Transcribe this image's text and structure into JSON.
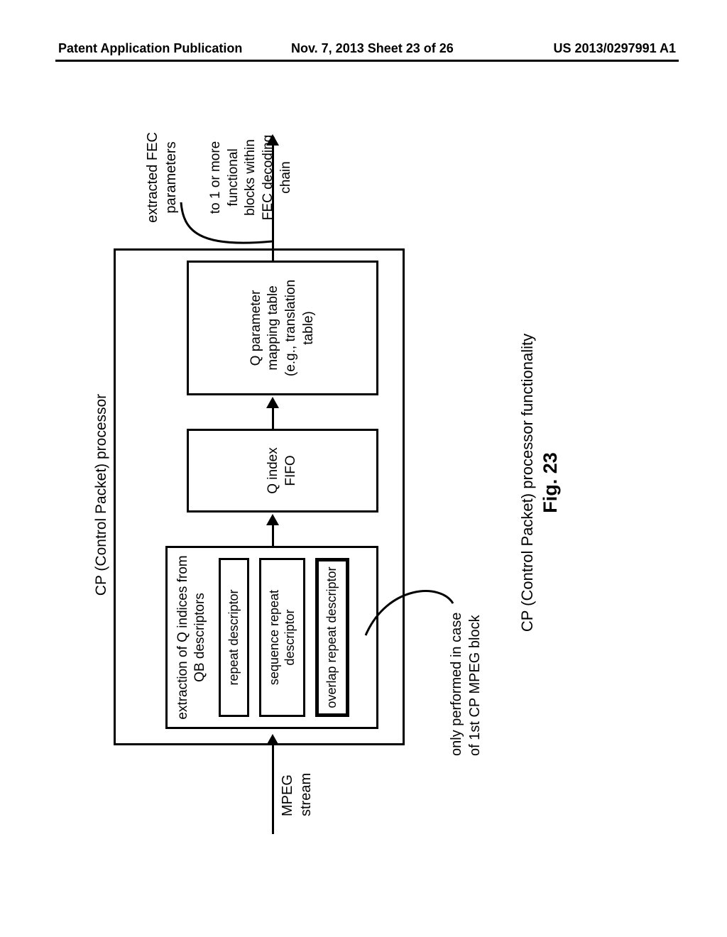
{
  "header": {
    "left": "Patent Application Publication",
    "mid": "Nov. 7, 2013   Sheet 23 of 26",
    "right": "US 2013/0297991 A1"
  },
  "diagram": {
    "cp_title": "CP (Control Packet) processor",
    "extract_title_l1": "extraction of Q indices from",
    "extract_title_l2": "QB descriptors",
    "desc_repeat": "repeat descriptor",
    "desc_seq_l1": "sequence repeat",
    "desc_seq_l2": "descriptor",
    "desc_overlap": "overlap repeat descriptor",
    "fifo_l1": "Q index",
    "fifo_l2": "FIFO",
    "map_l1": "Q parameter",
    "map_l2": "mapping table",
    "map_l3": "(e.g., translation",
    "map_l4": "table)",
    "input_l1": "MPEG",
    "input_l2": "stream",
    "note_l1": "only performed in case",
    "note_l2": "of 1st CP MPEG block",
    "out_label_l1": "extracted FEC",
    "out_label_l2": "parameters",
    "out_dest_l1": "to 1 or more",
    "out_dest_l2": "functional",
    "out_dest_l3": "blocks within",
    "out_dest_l4": "FEC decoding",
    "out_dest_l5": "chain"
  },
  "caption": {
    "line1": "CP (Control Packet) processor functionality",
    "fig": "Fig. 23"
  }
}
